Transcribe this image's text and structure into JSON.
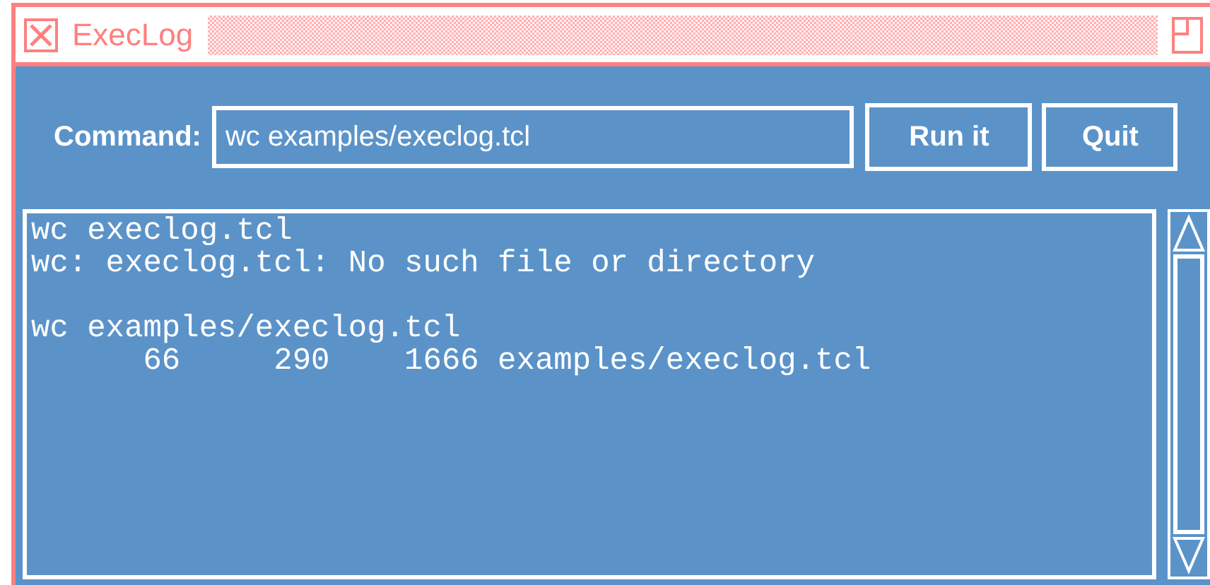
{
  "window": {
    "title": "ExecLog"
  },
  "command": {
    "label": "Command:",
    "value": "wc examples/execlog.tcl"
  },
  "buttons": [
    {
      "label": "Run it"
    },
    {
      "label": "Quit"
    }
  ],
  "log": [
    {
      "command": "wc execlog.tcl",
      "output": [
        "wc: execlog.tcl: No such file or directory"
      ]
    },
    {
      "command": "wc examples/execlog.tcl",
      "output": [
        "      66     290    1666 examples/execlog.tcl"
      ]
    }
  ]
}
